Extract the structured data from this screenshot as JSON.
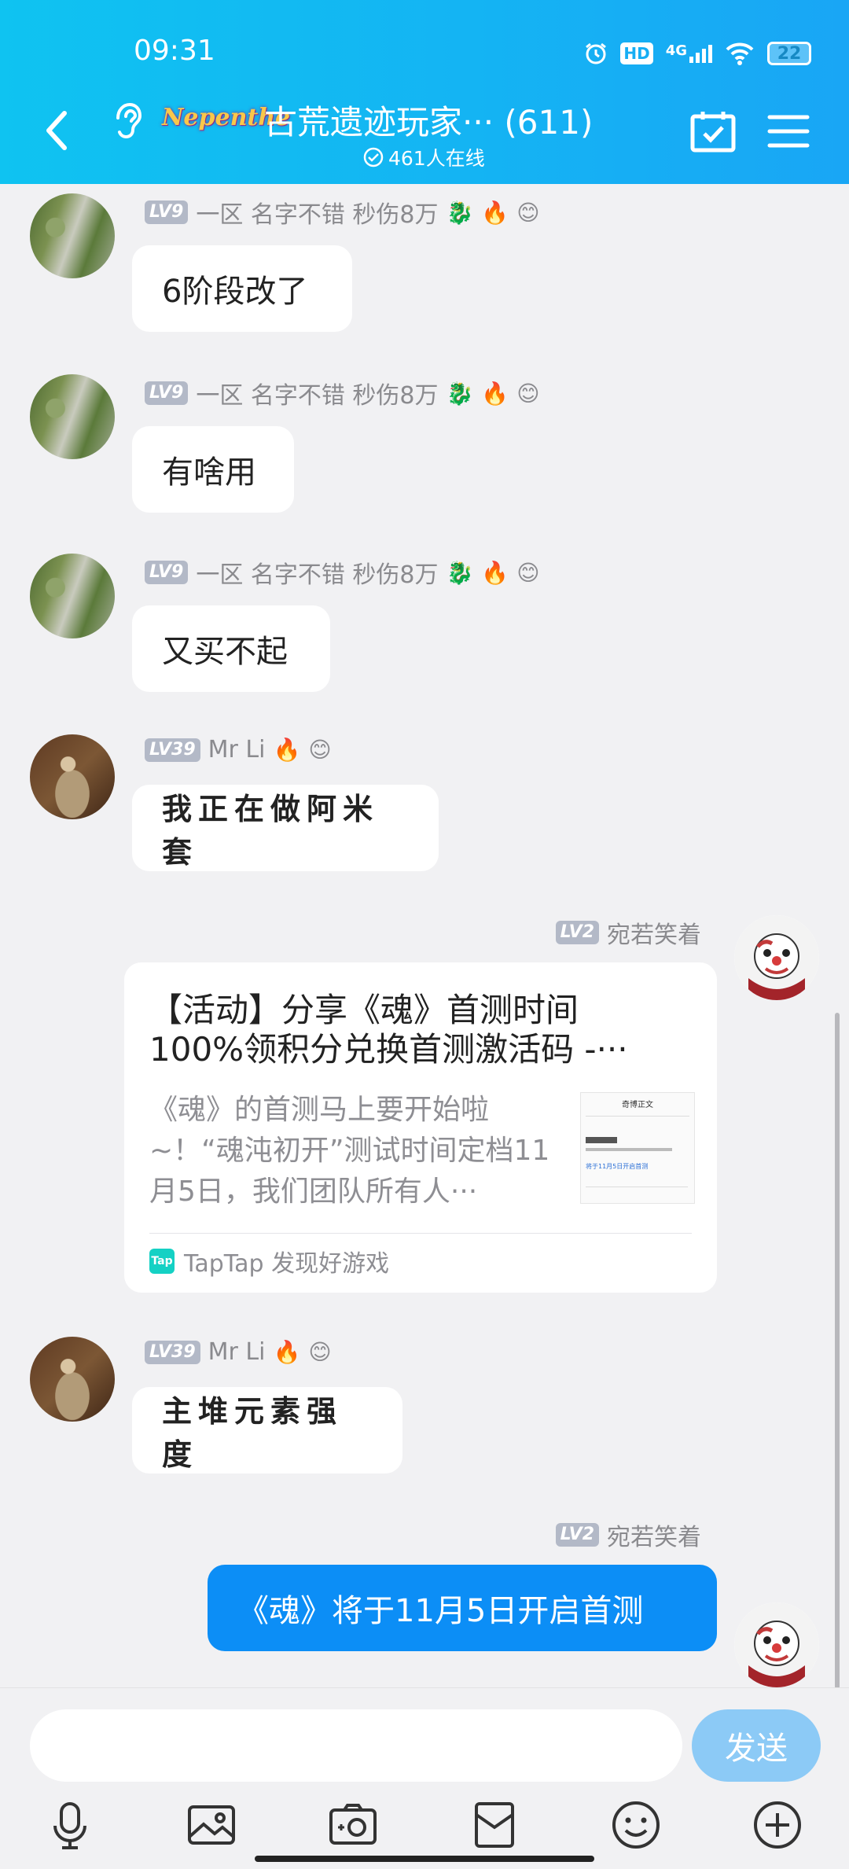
{
  "status_bar": {
    "time": "09:31",
    "hd": "HD",
    "network": "4G",
    "battery": "22"
  },
  "header": {
    "logo_text": "Nepenthe",
    "title": "古荒遗迹玩家··· (611)",
    "online": "461人在线"
  },
  "messages": [
    {
      "level": "LV9",
      "meta": "一区  名字不错  秒伤8万",
      "text": "6阶段改了"
    },
    {
      "level": "LV9",
      "meta": "一区  名字不错  秒伤8万",
      "text": "有啥用"
    },
    {
      "level": "LV9",
      "meta": "一区  名字不错  秒伤8万",
      "text": "又买不起"
    },
    {
      "level": "LV39",
      "meta": "Mr Li",
      "text": "我正在做阿米套"
    },
    {
      "level": "LV2",
      "meta": "宛若笑着"
    },
    {
      "level": "LV39",
      "meta": "Mr Li",
      "text": "主堆元素强度"
    },
    {
      "level": "LV2",
      "meta": "宛若笑着",
      "text": "《魂》将于11月5日开启首测"
    }
  ],
  "share_card": {
    "title_line1": "【活动】分享《魂》首测时间",
    "title_line2": "100%领积分兑换首测激活码 -···",
    "desc": "《魂》的首测马上要开始啦~！“魂沌初开”测试时间定档11月5日，我们团队所有人···",
    "thumb_heading": "奇博正文",
    "thumb_link": "将于11月5日开启首测",
    "source_icon": "Tap",
    "source": "TapTap 发现好游戏"
  },
  "input": {
    "placeholder": "",
    "send_label": "发送"
  },
  "icons": [
    "back-icon",
    "ear-icon",
    "calendar-check-icon",
    "menu-icon",
    "mic-icon",
    "image-icon",
    "camera-icon",
    "envelope-icon",
    "emoji-icon",
    "plus-icon"
  ],
  "colors": {
    "header_start": "#0FC3F1",
    "header_end": "#19A6F5",
    "my_bubble": "#0C8EF6",
    "send_button": "#8CCAF6",
    "level_badge": "#B3B9C7"
  }
}
